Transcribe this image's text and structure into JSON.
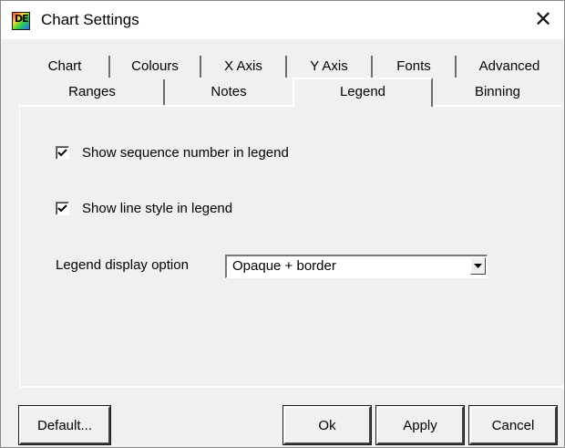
{
  "window": {
    "title": "Chart Settings",
    "app_icon": "DE-app-icon",
    "close_glyph": "✕"
  },
  "tabs": {
    "row1": [
      "Chart",
      "Colours",
      "X Axis",
      "Y Axis",
      "Fonts",
      "Advanced"
    ],
    "row2": [
      "Ranges",
      "Notes",
      "Legend",
      "Binning"
    ],
    "active": "Legend"
  },
  "legend_tab": {
    "show_sequence": {
      "label": "Show sequence number in legend",
      "checked": true
    },
    "show_line_style": {
      "label": "Show line style in legend",
      "checked": true
    },
    "display_option": {
      "label": "Legend display option",
      "selected": "Opaque + border"
    }
  },
  "buttons": {
    "default": "Default...",
    "ok": "Ok",
    "apply": "Apply",
    "cancel": "Cancel"
  }
}
